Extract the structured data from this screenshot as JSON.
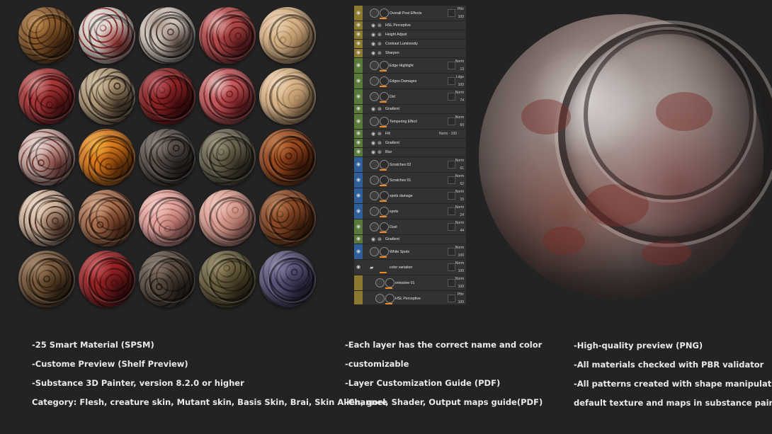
{
  "materials": [
    {
      "colors": [
        "#8a5a2b",
        "#4a2c14",
        "#c79257"
      ]
    },
    {
      "colors": [
        "#d8cfc9",
        "#8c2b2b",
        "#e8e2de"
      ]
    },
    {
      "colors": [
        "#cfc6bd",
        "#5b4a42",
        "#a99488"
      ]
    },
    {
      "colors": [
        "#b44b4b",
        "#6b1f22",
        "#e8b0ac"
      ]
    },
    {
      "colors": [
        "#d8b48a",
        "#b08a60",
        "#ecd2b0"
      ]
    },
    {
      "colors": [
        "#a8383a",
        "#5e1416",
        "#d28a86"
      ]
    },
    {
      "colors": [
        "#b09a7a",
        "#4a3a2a",
        "#d2c0a0"
      ]
    },
    {
      "colors": [
        "#8e2426",
        "#4a0e10",
        "#c4606a"
      ]
    },
    {
      "colors": [
        "#c25a5e",
        "#7a1e22",
        "#ecc4c0"
      ]
    },
    {
      "colors": [
        "#d9b58b",
        "#b68e62",
        "#efd7b8"
      ]
    },
    {
      "colors": [
        "#c8a8a2",
        "#7a3e38",
        "#e8d8d2"
      ]
    },
    {
      "colors": [
        "#d87a1e",
        "#7a3a08",
        "#f2b040"
      ]
    },
    {
      "colors": [
        "#5a504a",
        "#262220",
        "#8a7e76"
      ]
    },
    {
      "colors": [
        "#6a6450",
        "#383224",
        "#9a927a"
      ]
    },
    {
      "colors": [
        "#9a4a20",
        "#4a1e0a",
        "#c87a44"
      ]
    },
    {
      "colors": [
        "#d0b6a0",
        "#5a3a2a",
        "#ecd8c6"
      ]
    },
    {
      "colors": [
        "#a87050",
        "#5a2e1a",
        "#d4a686"
      ]
    },
    {
      "colors": [
        "#e2a6a0",
        "#b06a64",
        "#f4cac4"
      ]
    },
    {
      "colors": [
        "#dca296",
        "#b4766a",
        "#f0c6bc"
      ]
    },
    {
      "colors": [
        "#8a4a26",
        "#4a2410",
        "#b87a50"
      ]
    },
    {
      "colors": [
        "#7a5a3e",
        "#3a2816",
        "#a8886a"
      ]
    },
    {
      "colors": [
        "#9a2426",
        "#501012",
        "#c85a5c"
      ]
    },
    {
      "colors": [
        "#5e4e42",
        "#2a221c",
        "#8a7a6c"
      ]
    },
    {
      "colors": [
        "#6a5e3e",
        "#3a321e",
        "#9a8e6a"
      ]
    },
    {
      "colors": [
        "#5a5478",
        "#2e2a44",
        "#8a86a8"
      ]
    }
  ],
  "layers": [
    {
      "size": "big",
      "stripe": "#8c7a2e",
      "eye": true,
      "name": "Overall Post Effects",
      "mode": "Pthr",
      "value": "100",
      "box": true
    },
    {
      "size": "small",
      "stripe": "#8c7a2e",
      "eye": true,
      "fx": true,
      "name": "HSL Perceptive"
    },
    {
      "size": "small",
      "stripe": "#8c7a2e",
      "eye": true,
      "fx": true,
      "name": "Height Adjust"
    },
    {
      "size": "small",
      "stripe": "#8c7a2e",
      "eye": true,
      "fx": true,
      "name": "Contrast Luminosity"
    },
    {
      "size": "small",
      "stripe": "#8c7a2e",
      "eye": true,
      "fx": true,
      "name": "Sharpen"
    },
    {
      "size": "big",
      "stripe": "#5a7a3a",
      "eye": true,
      "name": "Edge Highlight",
      "mode": "Norm",
      "value": "13",
      "box": true
    },
    {
      "size": "big",
      "stripe": "#5a7a3a",
      "eye": true,
      "name": "Edges Damages",
      "mode": "Ldge",
      "value": "100",
      "box": true
    },
    {
      "size": "big",
      "stripe": "#5a7a3a",
      "eye": true,
      "name": "Dirt",
      "mode": "Norm",
      "value": "74",
      "box": true
    },
    {
      "size": "small",
      "stripe": "#5a7a3a",
      "eye": true,
      "fx": true,
      "name": "Gradient"
    },
    {
      "size": "big",
      "stripe": "#5a7a3a",
      "eye": true,
      "name": "Tempering Effect",
      "mode": "Norm",
      "value": "60",
      "box": true
    },
    {
      "size": "small",
      "stripe": "#5a7a3a",
      "eye": true,
      "fx": true,
      "name": "Fill",
      "inline": "Norm · 100 ·"
    },
    {
      "size": "small",
      "stripe": "#5a7a3a",
      "eye": true,
      "fx": true,
      "name": "Gradient"
    },
    {
      "size": "small",
      "stripe": "#5a7a3a",
      "eye": true,
      "fx": true,
      "name": "Blur"
    },
    {
      "size": "big",
      "stripe": "#2e5f9a",
      "eye": true,
      "name": "Scratches 02",
      "mode": "Norm",
      "value": "61",
      "box": true
    },
    {
      "size": "big",
      "stripe": "#2e5f9a",
      "eye": true,
      "name": "Scratches 01",
      "mode": "Norm",
      "value": "52",
      "box": true
    },
    {
      "size": "big",
      "stripe": "#2e5f9a",
      "eye": true,
      "name": "spots damage",
      "mode": "Norm",
      "value": "15",
      "box": true
    },
    {
      "size": "big",
      "stripe": "#2e5f9a",
      "eye": true,
      "name": "spots",
      "mode": "Norm",
      "value": "24",
      "box": true
    },
    {
      "size": "big",
      "stripe": "#5a7a3a",
      "eye": true,
      "name": "Dust",
      "mode": "Norm",
      "value": "44",
      "box": true
    },
    {
      "size": "small",
      "stripe": "#5a7a3a",
      "eye": true,
      "fx": true,
      "name": "Gradient"
    },
    {
      "size": "big",
      "stripe": "#2e5f9a",
      "eye": true,
      "name": "White Spots",
      "mode": "Norm",
      "value": "100",
      "box": true
    },
    {
      "size": "big",
      "stripe": "#323232",
      "eye": true,
      "folder": true,
      "name": "color variation",
      "mode": "Norm",
      "value": "100",
      "box": true
    },
    {
      "size": "big",
      "stripe": "#8c7a2e",
      "eye": false,
      "indent": true,
      "name": "emissive 01",
      "mode": "Norm",
      "value": "100",
      "box": true
    },
    {
      "size": "big",
      "stripe": "#8c7a2e",
      "eye": false,
      "indent": true,
      "name": "HSL Perceptive",
      "mode": "Pthr",
      "value": "100",
      "box": true
    },
    {
      "size": "small",
      "stripe": "#8c7a2e",
      "eye": false,
      "indent": true,
      "name": ""
    }
  ],
  "features": {
    "col1": [
      "-25 Smart Material  (SPSM)",
      "-Custome Preview (Shelf Preview)",
      "-Substance 3D Painter, version 8.2.0 or higher",
      "Category: Flesh, creature skin, Mutant skin, Basis Skin, Brai, Skin Alien, gore"
    ],
    "col2": [
      "-Each layer has the correct name and color",
      "-customizable",
      "-Layer Customization Guide (PDF)",
      "-Channel, Shader, Output maps guide(PDF)"
    ],
    "col3": [
      "-High-quality preview (PNG)",
      "-All materials checked with PBR validator",
      "-All patterns created with shape manipulation using",
      "default texture and maps in substance painter"
    ]
  }
}
